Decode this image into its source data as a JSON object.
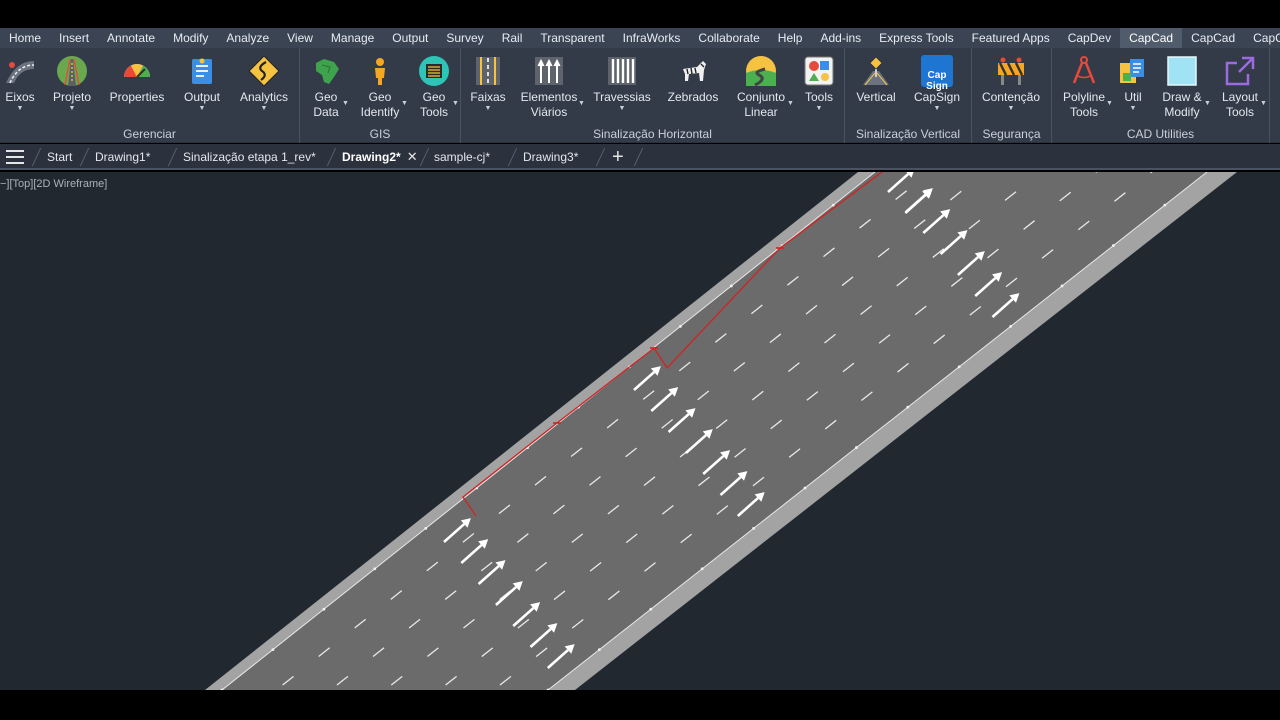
{
  "menu": [
    {
      "label": "Home"
    },
    {
      "label": "Insert"
    },
    {
      "label": "Annotate"
    },
    {
      "label": "Modify"
    },
    {
      "label": "Analyze"
    },
    {
      "label": "View"
    },
    {
      "label": "Manage"
    },
    {
      "label": "Output"
    },
    {
      "label": "Survey"
    },
    {
      "label": "Rail"
    },
    {
      "label": "Transparent"
    },
    {
      "label": "InfraWorks"
    },
    {
      "label": "Collaborate"
    },
    {
      "label": "Help"
    },
    {
      "label": "Add-ins"
    },
    {
      "label": "Express Tools"
    },
    {
      "label": "Featured Apps"
    },
    {
      "label": "CapDev"
    },
    {
      "label": "CapCad",
      "active": true
    },
    {
      "label": "CapCad"
    },
    {
      "label": "CapCad"
    },
    {
      "label": "C"
    }
  ],
  "ribbon": {
    "gerenciar": {
      "title": "Gerenciar",
      "buttons": [
        "Eixos",
        "Projeto",
        "Properties",
        "Output",
        "Analytics"
      ]
    },
    "gis": {
      "title": "GIS",
      "buttons": [
        "Geo\nData",
        "Geo\nIdentify",
        "Geo\nTools"
      ]
    },
    "sinalizacao_horizontal": {
      "title": "Sinalização Horizontal",
      "buttons": [
        "Faixas",
        "Elementos\nViários",
        "Travessias",
        "Zebrados",
        "Conjunto\nLinear",
        "Tools"
      ]
    },
    "sinalizacao_vertical": {
      "title": "Sinalização Vertical",
      "buttons": [
        "Vertical",
        "CapSign"
      ],
      "capsign_badge": "Cap\nSign"
    },
    "seguranca": {
      "title": "Segurança",
      "buttons": [
        "Contenção"
      ]
    },
    "cad_utilities": {
      "title": "CAD Utilities",
      "buttons": [
        "Polyline\nTools",
        "Util",
        "Draw &\nModify",
        "Layout\nTools"
      ]
    }
  },
  "doc_tabs": {
    "tabs": [
      "Start",
      "Drawing1*",
      "Sinalização etapa 1_rev*",
      "Drawing2*",
      "sample-cj*",
      "Drawing3*"
    ],
    "active_index": 3,
    "close_glyph": "✕",
    "new_tab_glyph": "+"
  },
  "viewport": {
    "label": "−][Top][2D Wireframe]"
  },
  "colors": {
    "menu_bg": "#3b4453",
    "ribbon_bg": "#333b48",
    "canvas_bg": "#212830",
    "road_asphalt": "#6b6b6b",
    "road_shoulder": "#a3a3a3",
    "lane_marking": "#ffffff",
    "selection_red": "#d22222"
  }
}
